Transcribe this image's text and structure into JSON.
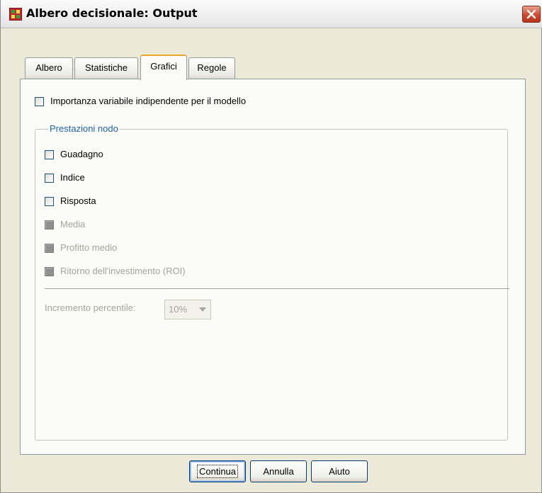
{
  "window": {
    "title": "Albero decisionale: Output",
    "icon": "decision-tree-app-icon",
    "close_icon": "close-icon"
  },
  "tabs": [
    {
      "label": "Albero",
      "active": false
    },
    {
      "label": "Statistiche",
      "active": false
    },
    {
      "label": "Grafici",
      "active": true
    },
    {
      "label": "Regole",
      "active": false
    }
  ],
  "options": {
    "importance": {
      "label": "Importanza variabile indipendente per il modello",
      "checked": false
    }
  },
  "node_performance": {
    "title": "Prestazioni nodo",
    "items": [
      {
        "label": "Guadagno",
        "checked": false,
        "enabled": true
      },
      {
        "label": "Indice",
        "checked": false,
        "enabled": true
      },
      {
        "label": "Risposta",
        "checked": false,
        "enabled": true
      },
      {
        "label": "Media",
        "checked": false,
        "enabled": false
      },
      {
        "label": "Profitto medio",
        "checked": false,
        "enabled": false
      },
      {
        "label": "Ritorno dell'investimento (ROI)",
        "checked": false,
        "enabled": false
      }
    ],
    "percentile": {
      "label": "Incremento percentile:",
      "value": "10%",
      "enabled": false
    }
  },
  "buttons": {
    "continue": "Continua",
    "cancel": "Annulla",
    "help": "Aiuto"
  },
  "colors": {
    "accent_tab": "#e8a52a",
    "group_title": "#1f5fb5",
    "close_button": "#cc4b32"
  }
}
